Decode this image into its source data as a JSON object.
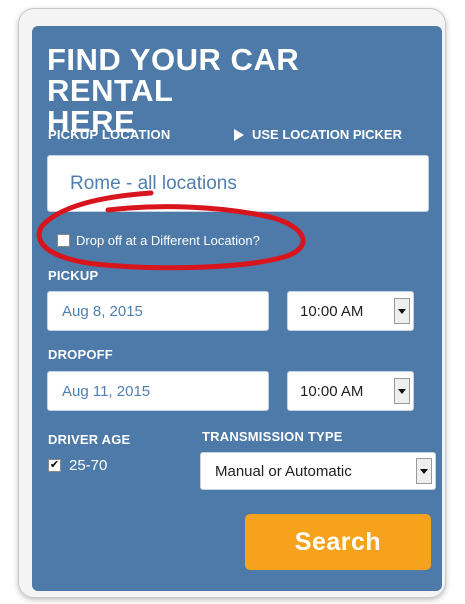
{
  "form": {
    "title_line1": "FIND YOUR CAR RENTAL",
    "title_line2": "HERE",
    "pickup_location_label": "PICKUP LOCATION",
    "location_picker_link": "USE LOCATION PICKER",
    "location_value": "Rome - all locations",
    "dropoff_different_label": "Drop off at a Different Location?",
    "dropoff_different_checked": false,
    "pickup_label": "PICKUP",
    "pickup_date": "Aug 8, 2015",
    "pickup_time": "10:00 AM",
    "dropoff_label": "DROPOFF",
    "dropoff_date": "Aug 11, 2015",
    "dropoff_time": "10:00 AM",
    "driver_age_label": "DRIVER AGE",
    "driver_age_value": "25-70",
    "driver_age_checked": true,
    "transmission_label": "TRANSMISSION TYPE",
    "transmission_value": "Manual or Automatic",
    "search_label": "Search"
  },
  "colors": {
    "panel": "#4d7aa8",
    "search_button": "#f6a21d",
    "annotation": "#d8141c"
  },
  "icons": {
    "picker_link": "play-triangle-icon",
    "select_toggle": "chevron-down-icon"
  }
}
